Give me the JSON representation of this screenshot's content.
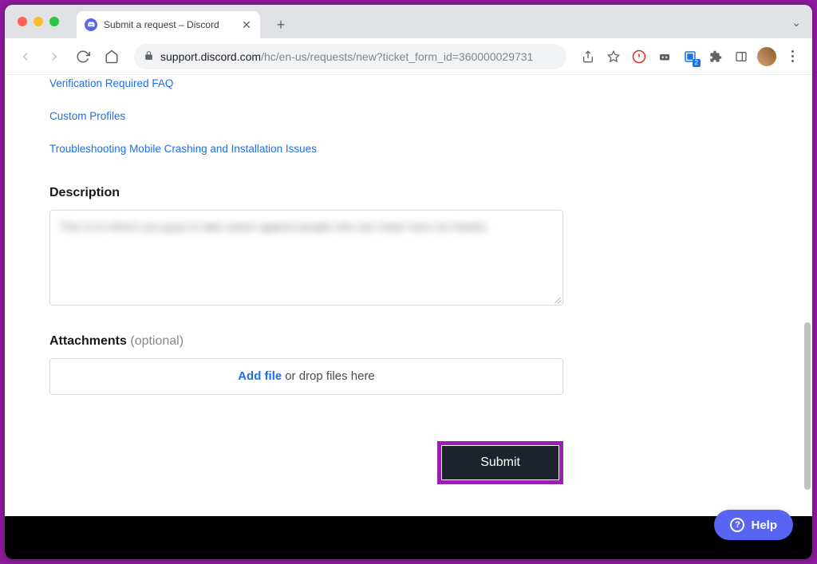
{
  "browser": {
    "tab_title": "Submit a request – Discord",
    "url_domain": "support.discord.com",
    "url_path": "/hc/en-us/requests/new?ticket_form_id=360000029731"
  },
  "faq_links": [
    "Verification Required FAQ",
    "Custom Profiles",
    "Troubleshooting Mobile Crashing and Installation Issues"
  ],
  "form": {
    "description_label": "Description",
    "description_value": "This is to inform you guys to take action against people who are mean here our thanks",
    "attachments_label": "Attachments",
    "attachments_optional": "(optional)",
    "add_file_label": "Add file",
    "drop_files_label": "or drop files here",
    "submit_label": "Submit"
  },
  "help_widget": {
    "label": "Help"
  }
}
